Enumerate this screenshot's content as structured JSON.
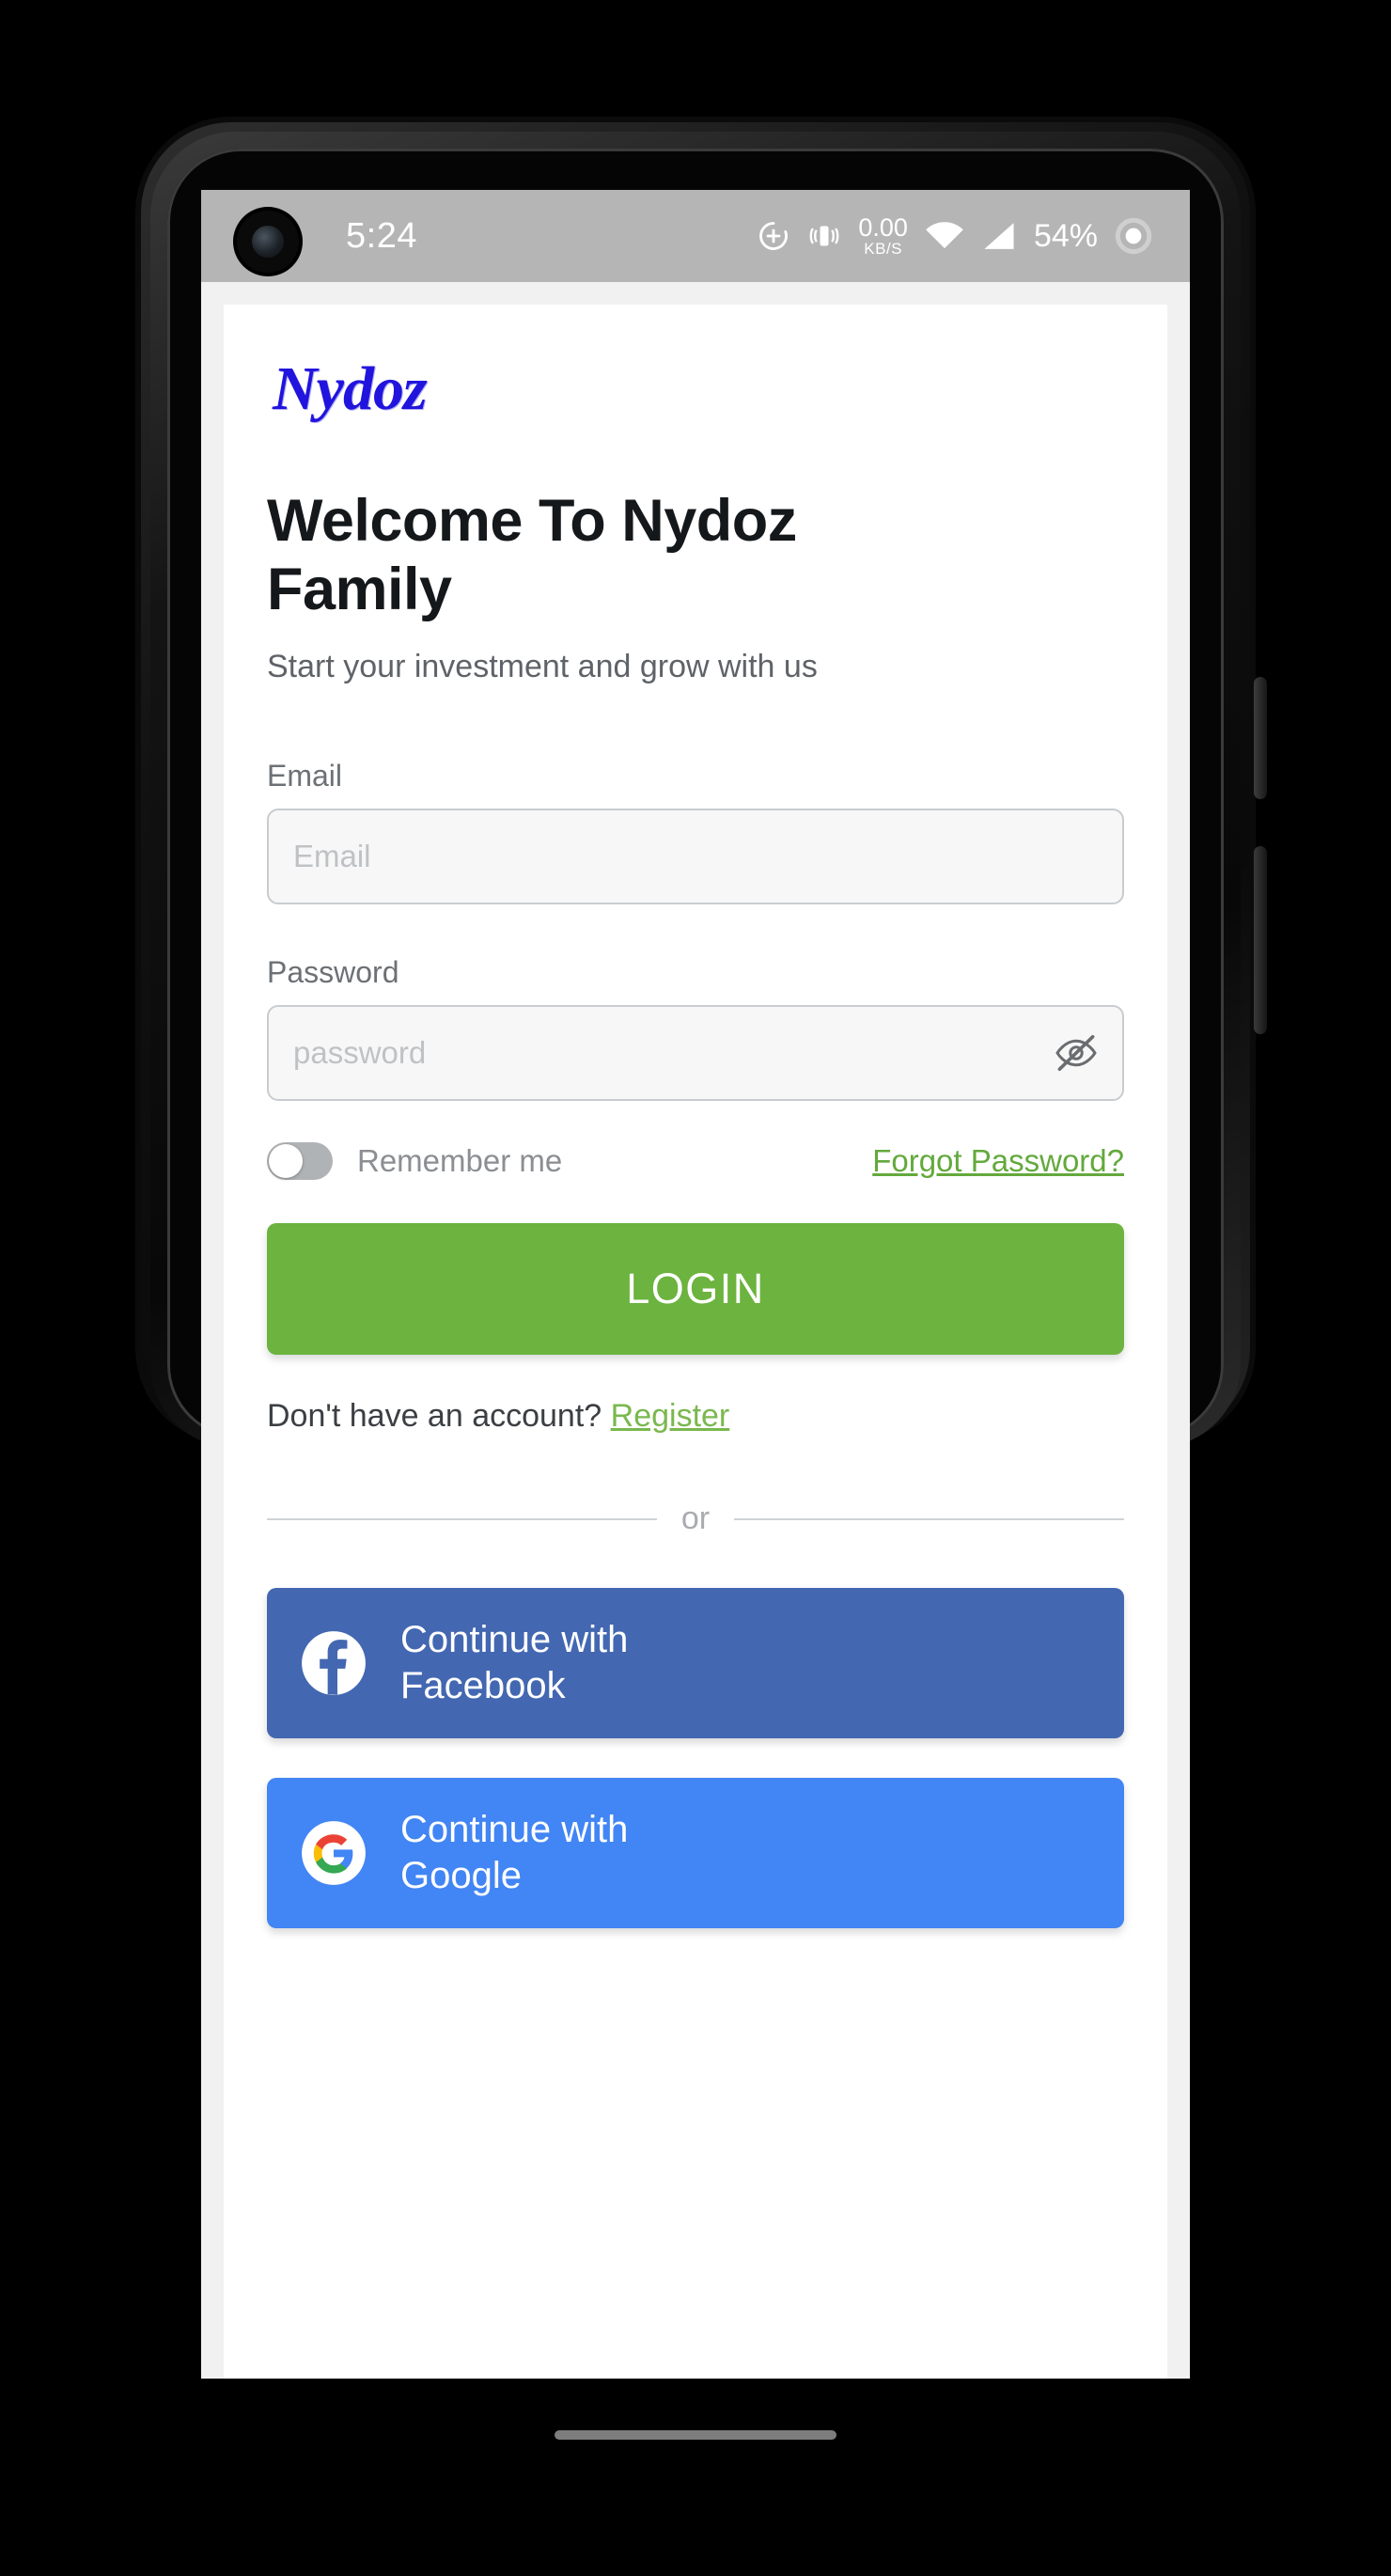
{
  "status_bar": {
    "time": "5:24",
    "network_speed_value": "0.00",
    "network_speed_unit": "KB/S",
    "battery_percent": "54%",
    "icons": [
      "location-icon",
      "vibrate-icon",
      "wifi-icon",
      "cellular-signal-icon",
      "battery-circle-icon"
    ]
  },
  "brand": {
    "name": "Nydoz",
    "color": "#2114dd"
  },
  "header": {
    "title": "Welcome To Nydoz Family",
    "subtitle": "Start your investment and grow with us"
  },
  "form": {
    "email": {
      "label": "Email",
      "placeholder": "Email",
      "value": ""
    },
    "password": {
      "label": "Password",
      "placeholder": "password",
      "value": "",
      "toggle_icon": "eye-off-icon"
    },
    "remember_me": {
      "label": "Remember me",
      "checked": false
    },
    "forgot_password_label": "Forgot Password?",
    "login_button_label": "LOGIN",
    "login_button_color": "#6cb33f"
  },
  "register": {
    "prompt": "Don't have an account?",
    "link_label": "Register",
    "link_color": "#7ab84f"
  },
  "divider": {
    "text": "or"
  },
  "social": {
    "facebook": {
      "label": "Continue with Facebook",
      "icon": "facebook-icon",
      "color": "#4367b1"
    },
    "google": {
      "label": "Continue with Google",
      "icon": "google-icon",
      "color": "#4285f4"
    }
  }
}
